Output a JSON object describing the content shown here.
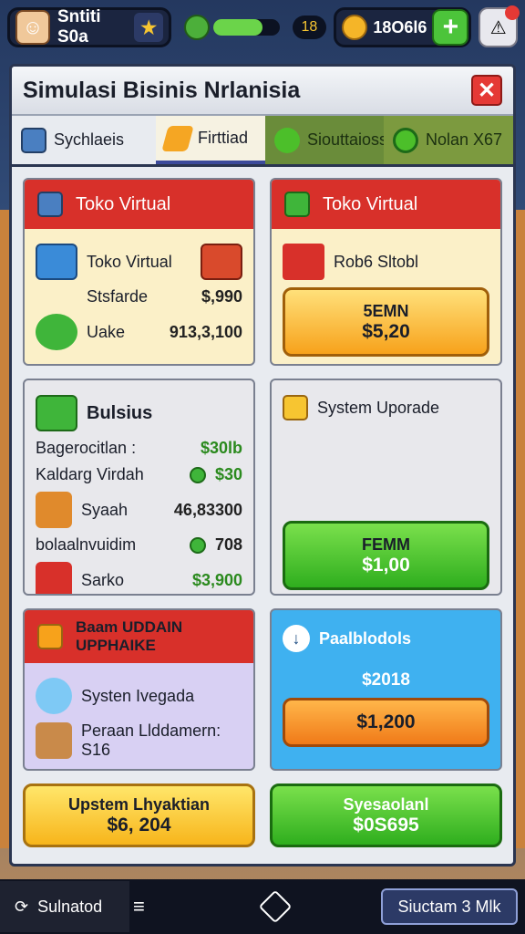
{
  "hud": {
    "player_name": "Sntiti S0a",
    "energy_value": "18",
    "energy_fraction": 0.75,
    "coins": "18O6l6"
  },
  "modal": {
    "title": "Simulasi Bisinis Nrlanisia",
    "tabs": [
      {
        "label": "Sychlaeis"
      },
      {
        "label": "Firttiad"
      },
      {
        "label": "Siouttaioss"
      },
      {
        "label": "Nolan X67"
      }
    ]
  },
  "cards": {
    "toko1": {
      "header": "Toko Virtual",
      "rows": [
        {
          "label": "Toko Virtual",
          "value": ""
        },
        {
          "label": "Stsfarde",
          "value": "$,990"
        },
        {
          "label": "Uake",
          "value": "913,3,100"
        }
      ]
    },
    "toko2": {
      "header": "Toko Virtual",
      "row_label": "Rob6 Sltobl",
      "btn_l1": "5EMN",
      "btn_l2": "$5,20"
    },
    "bisnis": {
      "title": "Bulsius",
      "rows": [
        {
          "label": "Bagerocitlan :",
          "value": "$30lb"
        },
        {
          "label": "Kaldarg Virdah",
          "value": "$30"
        },
        {
          "label": "Syaah",
          "value": "46,83300"
        },
        {
          "label": "bolaalnvuidim",
          "value": "708"
        },
        {
          "label": "Sarko",
          "value": "$3,900"
        }
      ]
    },
    "system": {
      "title": "System Uporade",
      "btn_l1": "FEMM",
      "btn_l2": "$1,00"
    },
    "upgrade": {
      "header_l1": "Baam UDDAIN",
      "header_l2": "UPPHAIKE",
      "rows": [
        {
          "label": "Systen Ivegada",
          "value": ""
        },
        {
          "label": "Peraan Llddamern: S16",
          "value": ""
        }
      ]
    },
    "pak": {
      "title": "Paalblodols",
      "value": "$2018",
      "btn_l2": "$1,200"
    },
    "bottom_left_btn": {
      "l1": "Upstem Lhyaktian",
      "l2": "$6, 204"
    },
    "bottom_right_btn": {
      "l1": "Syesaolanl",
      "l2": "$0S695"
    }
  },
  "bottom_bar": {
    "left_label": "Sulnatod",
    "right_label": "Siuctam 3 Mlk"
  },
  "colors": {
    "accent_red": "#d8302a",
    "button_green": "#2fae1e",
    "button_orange": "#f7a21b",
    "sky": "#3fb1f0"
  }
}
